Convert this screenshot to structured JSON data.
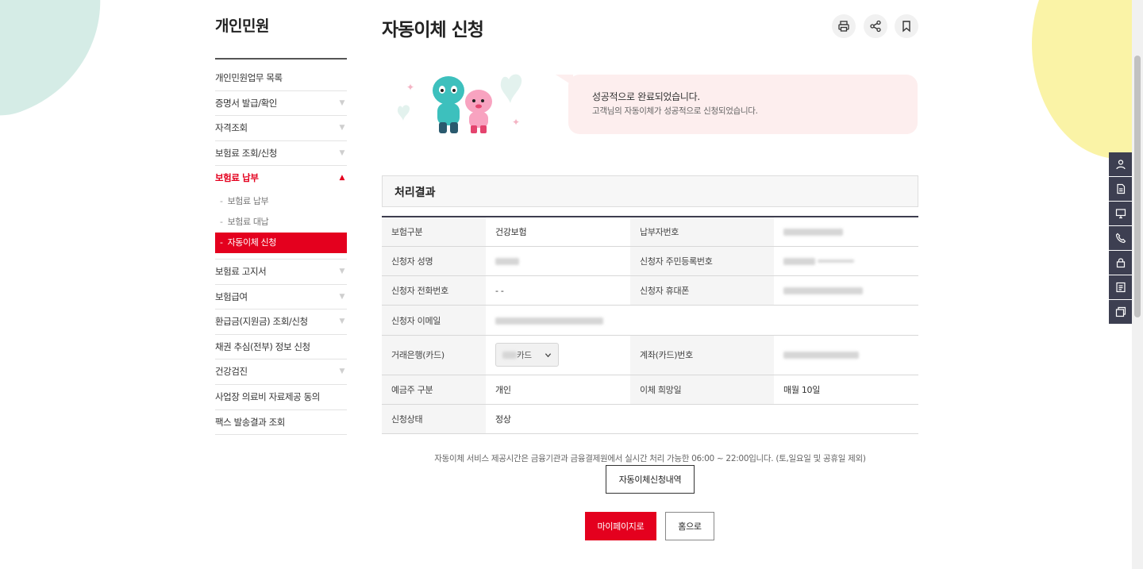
{
  "sidebar": {
    "title": "개인민원",
    "items": [
      {
        "label": "개인민원업무 목록"
      },
      {
        "label": "증명서 발급/확인",
        "caret": "▼"
      },
      {
        "label": "자격조회",
        "caret": "▼"
      },
      {
        "label": "보험료 조회/신청",
        "caret": "▼"
      },
      {
        "label": "보험료 납부",
        "caret": "▲"
      },
      {
        "label": "보험료 고지서",
        "caret": "▼"
      },
      {
        "label": "보험급여",
        "caret": "▼"
      },
      {
        "label": "환급금(지원금) 조회/신청",
        "caret": "▼"
      },
      {
        "label": "채권 추심(전부) 정보 신청"
      },
      {
        "label": "건강검진",
        "caret": "▼"
      },
      {
        "label": "사업장 의료비 자료제공 동의"
      },
      {
        "label": "팩스 발송결과 조회"
      }
    ],
    "submenu": [
      {
        "dash": "-",
        "label": "보험료 납부"
      },
      {
        "dash": "-",
        "label": "보험료 대납"
      },
      {
        "dash": "-",
        "label": "자동이체 신청"
      }
    ]
  },
  "header": {
    "title": "자동이체 신청",
    "tools": [
      "printer-icon",
      "share-icon",
      "bookmark-icon"
    ]
  },
  "banner": {
    "title": "성공적으로 완료되었습니다.",
    "desc": "고객님의 자동이체가 성공적으로 신청되었습니다."
  },
  "result": {
    "title": "처리결과",
    "rows": [
      {
        "k1": "보험구분",
        "v1": "건강보험",
        "k2": "납부자번호"
      },
      {
        "k1": "신청자 성명",
        "k2": "신청자 주민등록번호"
      },
      {
        "k1": "신청자 전화번호",
        "v1": "- -",
        "k2": "신청자 휴대폰"
      },
      {
        "k1": "신청자 이메일"
      },
      {
        "k1": "거래은행(카드)",
        "v1": "카드",
        "k2": "계좌(카드)번호"
      },
      {
        "k1": "예금주 구분",
        "v1": "개인",
        "k2": "이체 희망일",
        "v2": "매월 10일"
      },
      {
        "k1": "신청상태",
        "v1": "정상"
      }
    ]
  },
  "notice": "자동이체 서비스 제공시간은 금융기관과 금융결제원에서 실시간 처리 가능한 06:00 ~ 22:00입니다. (토,일요일 및 공휴일 제외)",
  "buttons": {
    "history": "자동이체신청내역",
    "mypage": "마이페이지로",
    "home": "홈으로"
  },
  "quick_menu": [
    "user-icon",
    "document-icon",
    "monitor-icon",
    "phone-icon",
    "lock-icon",
    "list-icon",
    "window-icon"
  ],
  "colors": {
    "accent": "#e4001e",
    "quick_bar": "#3d3f51",
    "banner_bg": "#fdeeee"
  }
}
